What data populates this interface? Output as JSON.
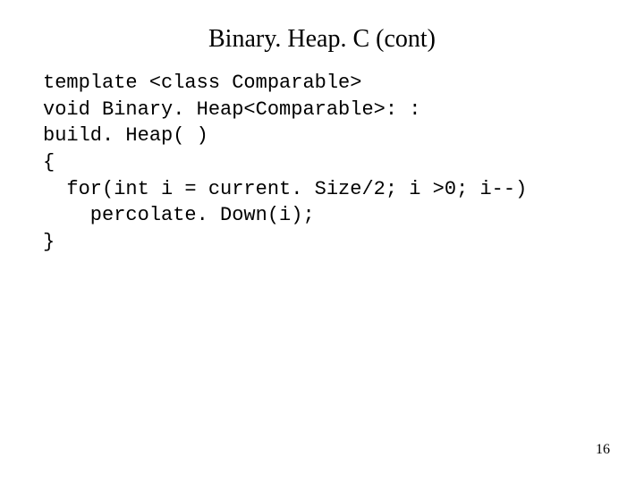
{
  "title": "Binary. Heap. C (cont)",
  "code": {
    "l1": "template <class Comparable>",
    "l2": "void Binary. Heap<Comparable>: :",
    "l3": "build. Heap( )",
    "l4": "{",
    "l5": "  for(int i = current. Size/2; i >0; i--)",
    "l6": "    percolate. Down(i);",
    "l7": "}"
  },
  "page_number": "16"
}
